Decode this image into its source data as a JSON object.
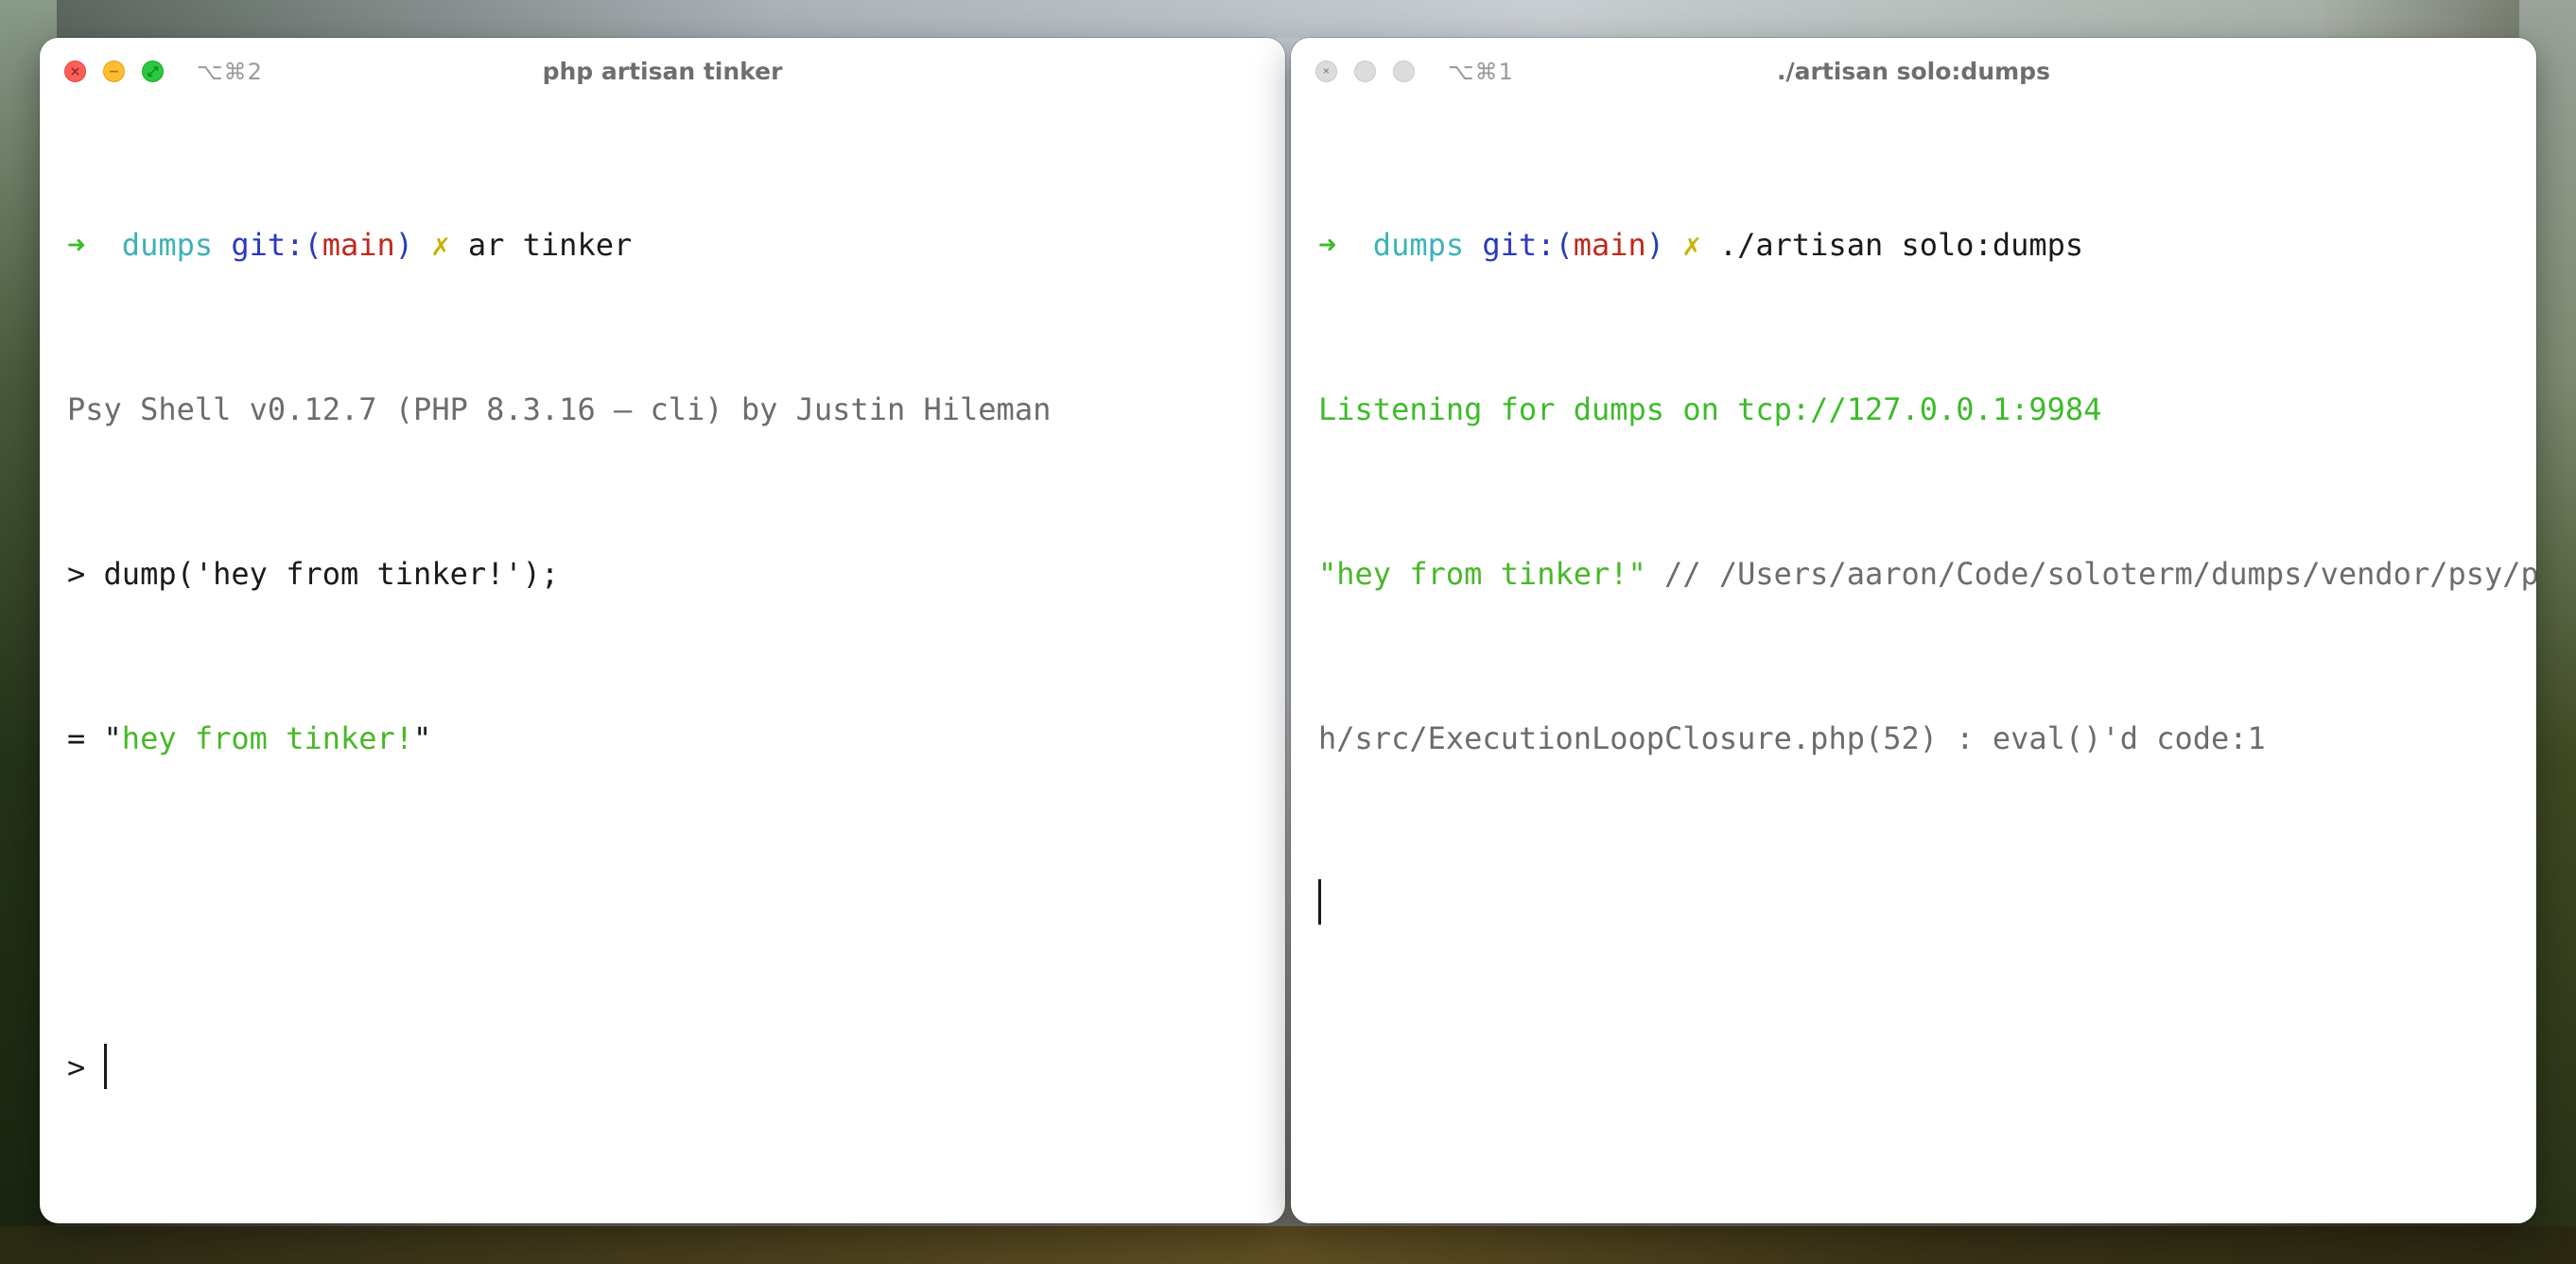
{
  "windows": {
    "left": {
      "shortcut": "⌥⌘2",
      "title": "php artisan tinker",
      "prompt": {
        "arrow": "➜",
        "dir": "dumps",
        "git_prefix": "git:(",
        "branch": "main",
        "git_suffix": ")",
        "dirty": "✗",
        "command": "ar tinker"
      },
      "banner": "Psy Shell v0.12.7 (PHP 8.3.16 — cli) by Justin Hileman",
      "input_prompt": ">",
      "input_code": "dump('hey from tinker!');",
      "result_prefix": "= \"",
      "result_value": "hey from tinker!",
      "result_suffix": "\"",
      "next_prompt": ">"
    },
    "right": {
      "shortcut": "⌥⌘1",
      "title": "./artisan solo:dumps",
      "prompt": {
        "arrow": "➜",
        "dir": "dumps",
        "git_prefix": "git:(",
        "branch": "main",
        "git_suffix": ")",
        "dirty": "✗",
        "command": "./artisan solo:dumps"
      },
      "listening": "Listening for dumps on tcp://127.0.0.1:9984",
      "dump_value": "\"hey from tinker!\"",
      "dump_source_1": " // /Users/aaron/Code/soloterm/dumps/vendor/psy/psys",
      "dump_source_2": "h/src/ExecutionLoopClosure.php(52) : eval()'d code:1"
    }
  },
  "traffic_lights": {
    "close_glyph": "×",
    "minimize_glyph": "−",
    "zoom_glyph": "⤢",
    "inactive_glyph": "×"
  },
  "colors": {
    "prompt_arrow": "#3dbb2a",
    "dir": "#3cb3b8",
    "git": "#2a39c0",
    "branch": "#c0291f",
    "dirty": "#c8b400",
    "string": "#48b829",
    "listening": "#3dbb2a"
  }
}
